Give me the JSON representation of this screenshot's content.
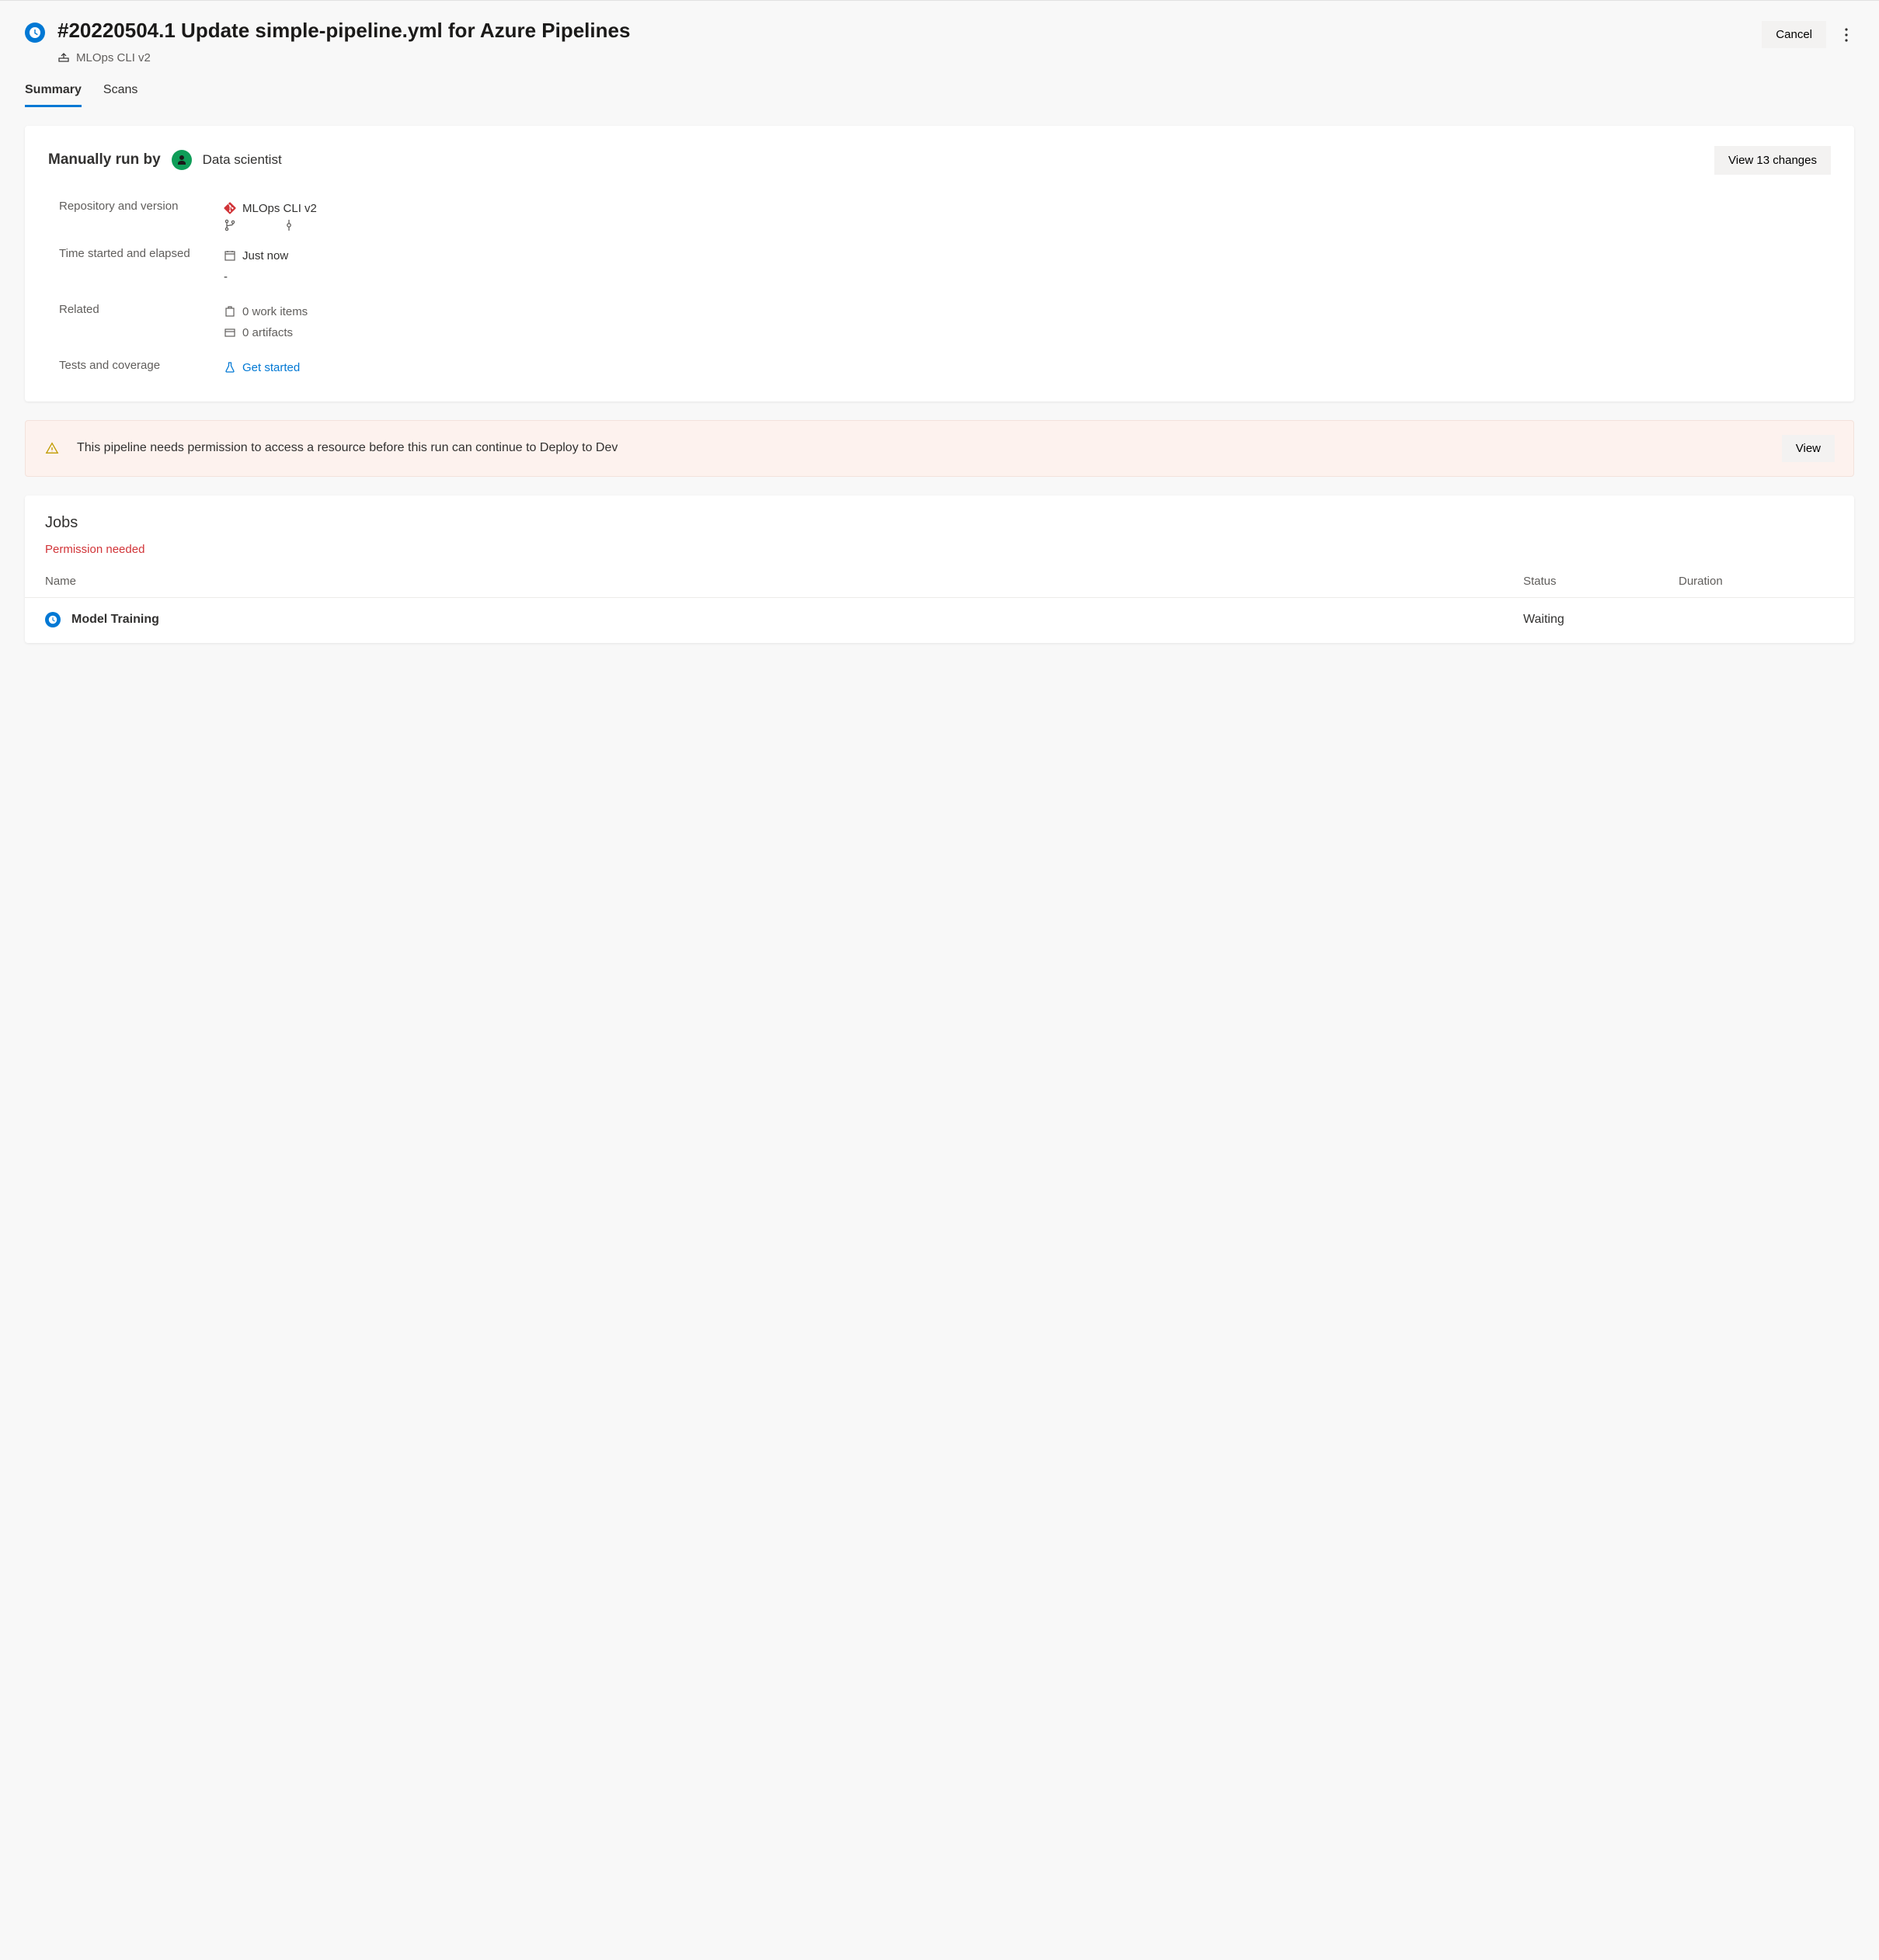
{
  "header": {
    "title": "#20220504.1 Update simple-pipeline.yml for Azure Pipelines",
    "pipeline_name": "MLOps CLI v2",
    "cancel_label": "Cancel"
  },
  "tabs": [
    {
      "label": "Summary",
      "active": true
    },
    {
      "label": "Scans",
      "active": false
    }
  ],
  "summary": {
    "run_by_label": "Manually run by",
    "run_by_user": "Data scientist",
    "view_changes_label": "View 13 changes",
    "rows": {
      "repo_label": "Repository and version",
      "repo_value": "MLOps CLI v2",
      "time_label": "Time started and elapsed",
      "time_started": "Just now",
      "time_elapsed": "-",
      "related_label": "Related",
      "work_items": "0 work items",
      "artifacts": "0 artifacts",
      "tests_label": "Tests and coverage",
      "tests_link": "Get started"
    }
  },
  "warning": {
    "text": "This pipeline needs permission to access a resource before this run can continue to Deploy to Dev",
    "view_label": "View"
  },
  "jobs": {
    "title": "Jobs",
    "permission_text": "Permission needed",
    "columns": {
      "name": "Name",
      "status": "Status",
      "duration": "Duration"
    },
    "rows": [
      {
        "name": "Model Training",
        "status": "Waiting",
        "duration": ""
      }
    ]
  }
}
